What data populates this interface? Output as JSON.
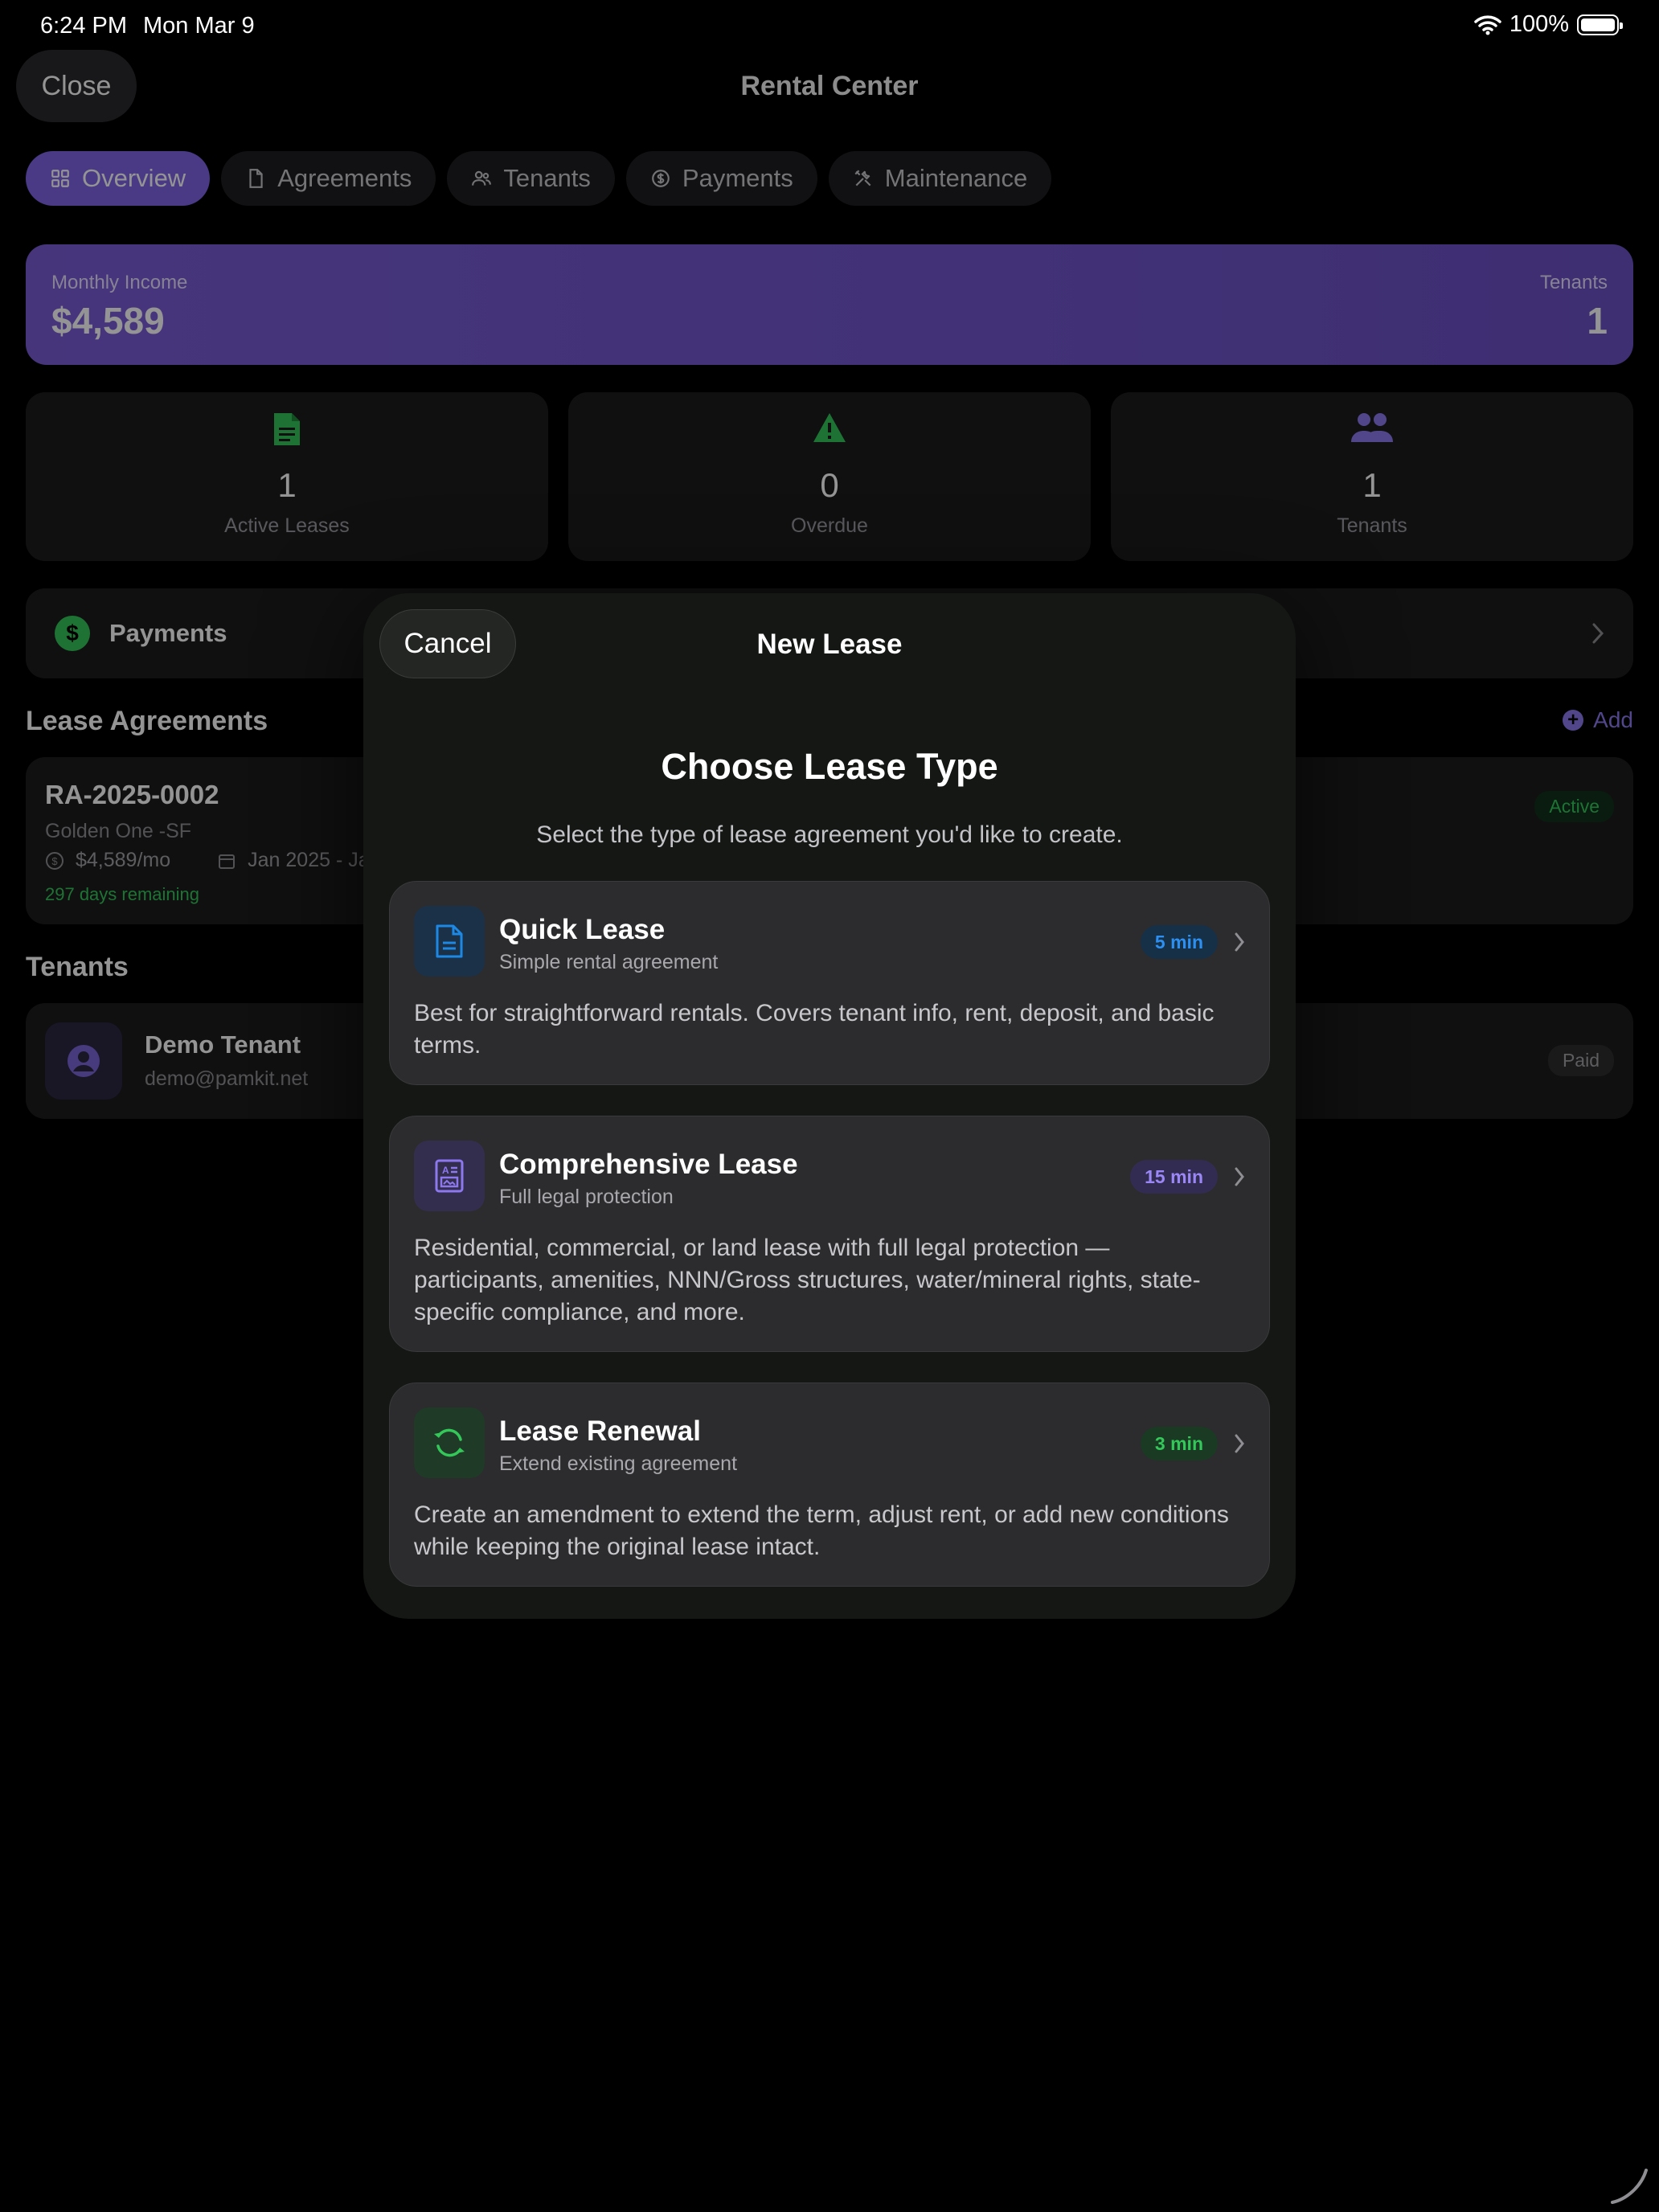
{
  "status_bar": {
    "time": "6:24 PM",
    "date": "Mon Mar 9",
    "battery": "100%"
  },
  "nav": {
    "close_label": "Close",
    "title": "Rental Center"
  },
  "tabs": [
    {
      "label": "Overview",
      "icon": "grid-icon",
      "active": true
    },
    {
      "label": "Agreements",
      "icon": "document-icon",
      "active": false
    },
    {
      "label": "Tenants",
      "icon": "people-icon",
      "active": false
    },
    {
      "label": "Payments",
      "icon": "dollar-circle-icon",
      "active": false
    },
    {
      "label": "Maintenance",
      "icon": "tools-icon",
      "active": false
    }
  ],
  "income": {
    "label": "Monthly Income",
    "value": "$4,589",
    "tenants_label": "Tenants",
    "tenants_value": "1"
  },
  "stats": [
    {
      "value": "1",
      "label": "Active Leases",
      "icon": "document-icon",
      "color": "#34c759"
    },
    {
      "value": "0",
      "label": "Overdue",
      "icon": "warning-icon",
      "color": "#34c759"
    },
    {
      "value": "1",
      "label": "Tenants",
      "icon": "people-icon",
      "color": "#8e78f0"
    }
  ],
  "payments_row": {
    "icon": "dollar-circle-icon",
    "label": "Payments"
  },
  "lease_section": {
    "title": "Lease Agreements",
    "add_label": "Add",
    "lease": {
      "id": "RA-2025-0002",
      "property": "Golden One -SF",
      "rent": "$4,589/mo",
      "dates": "Jan 2025 - Ja",
      "remaining": "297 days remaining",
      "status": "Active"
    }
  },
  "tenant_section": {
    "title": "Tenants",
    "tenant": {
      "name": "Demo Tenant",
      "email": "demo@pamkit.net",
      "status": "Paid"
    }
  },
  "modal": {
    "cancel_label": "Cancel",
    "title": "New Lease",
    "heading": "Choose Lease Type",
    "subheading": "Select the type of lease agreement you'd like to create.",
    "options": [
      {
        "title": "Quick Lease",
        "subtitle": "Simple rental agreement",
        "time": "5 min",
        "description": "Best for straightforward rentals. Covers tenant info, rent, deposit, and basic terms.",
        "icon": "document-icon",
        "accent": "#1e88e5"
      },
      {
        "title": "Comprehensive Lease",
        "subtitle": "Full legal protection",
        "time": "15 min",
        "description": "Residential, commercial, or land lease with full legal protection — participants, amenities, NNN/Gross structures, water/mineral rights, state-specific compliance, and more.",
        "icon": "contract-icon",
        "accent": "#8e78f0"
      },
      {
        "title": "Lease Renewal",
        "subtitle": "Extend existing agreement",
        "time": "3 min",
        "description": "Create an amendment to extend the term, adjust rent, or add new conditions while keeping the original lease intact.",
        "icon": "refresh-icon",
        "accent": "#34c759"
      }
    ]
  }
}
